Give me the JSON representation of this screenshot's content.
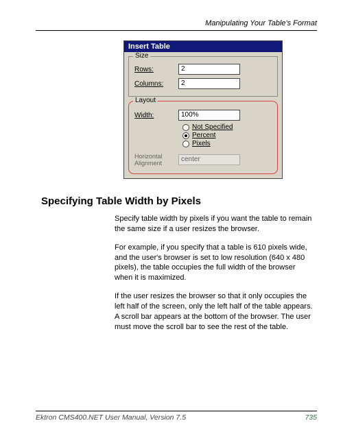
{
  "header": {
    "title": "Manipulating Your Table's Format"
  },
  "dialog": {
    "title": "Insert Table",
    "size": {
      "legend": "Size",
      "rows_label": "Rows:",
      "rows_value": "2",
      "cols_label": "Columns:",
      "cols_value": "2"
    },
    "layout": {
      "legend": "Layout",
      "width_label": "Width:",
      "width_value": "100%",
      "radios": {
        "not_specified": "Not Specified",
        "percent": "Percent",
        "pixels": "Pixels"
      },
      "ha_label": "Horizontal Alignment",
      "ha_value": "center"
    }
  },
  "section": {
    "heading": "Specifying Table Width by Pixels",
    "p1": "Specify table width by pixels if you want the table to remain the same size if a user resizes the browser.",
    "p2": "For example, if you specify that a table is 610 pixels wide, and the user's browser is set to low resolution (640 x 480 pixels), the table occupies the full width of the browser when it is maximized.",
    "p3": "If the user resizes the browser so that it only occupies the left half of the screen, only the left half of the table appears. A scroll bar appears at the bottom of the browser. The user must move the scroll bar to see the rest of the table."
  },
  "footer": {
    "left": "Ektron CMS400.NET User Manual, Version 7.5",
    "page": "735"
  }
}
